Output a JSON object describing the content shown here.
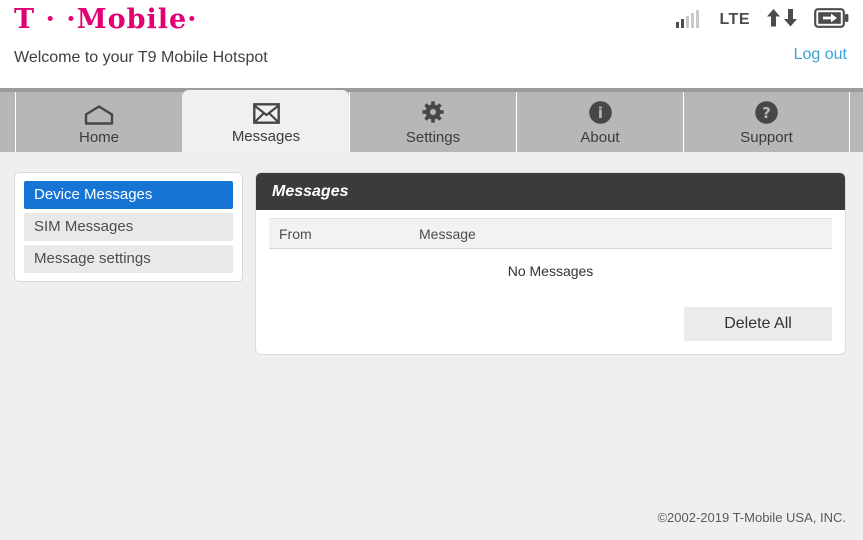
{
  "header": {
    "logo": "T · ·Mobile·",
    "welcome": "Welcome to your T9 Mobile Hotspot",
    "logout_label": "Log out",
    "network_label": "LTE",
    "status_icons": [
      "signal-bars-icon",
      "lte-label",
      "updown-arrows-icon",
      "battery-charging-icon"
    ]
  },
  "tabs": [
    {
      "label": "Home",
      "icon": "home-icon",
      "active": false
    },
    {
      "label": "Messages",
      "icon": "envelope-icon",
      "active": true
    },
    {
      "label": "Settings",
      "icon": "gear-icon",
      "active": false
    },
    {
      "label": "About",
      "icon": "info-icon",
      "active": false
    },
    {
      "label": "Support",
      "icon": "question-icon",
      "active": false
    }
  ],
  "sidebar": {
    "items": [
      {
        "label": "Device Messages",
        "selected": true
      },
      {
        "label": "SIM Messages",
        "selected": false
      },
      {
        "label": "Message settings",
        "selected": false
      }
    ]
  },
  "panel": {
    "title": "Messages",
    "table": {
      "columns": [
        "From",
        "Message"
      ],
      "rows": [],
      "empty_text": "No Messages"
    },
    "delete_all_label": "Delete All"
  },
  "footer": {
    "copyright": "©2002-2019 T-Mobile USA, INC."
  },
  "colors": {
    "brand_magenta": "#e20074",
    "selected_blue": "#1574d4",
    "link_blue": "#3fa0dc",
    "panel_header_dark": "#3b3b3b",
    "tabbar_gray": "#b7b7b7",
    "page_background": "#efefef"
  }
}
